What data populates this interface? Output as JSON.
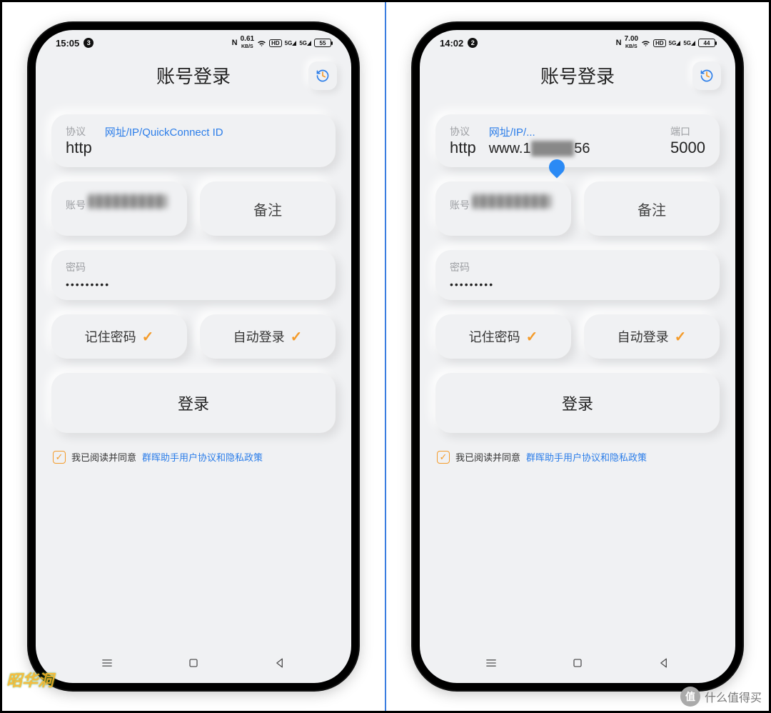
{
  "watermarks": {
    "left": "昭华洞",
    "right_char": "值",
    "right_text": "什么值得买"
  },
  "left": {
    "status": {
      "time": "15:05",
      "badge": "3",
      "kbs_n": "0.61",
      "kbs_u": "KB/S",
      "hd": "HD",
      "sig": "5G",
      "batt": "55"
    },
    "title": "账号登录",
    "addr": {
      "proto_label": "协议",
      "proto_value": "http",
      "main_label": "网址/IP/QuickConnect ID",
      "main_value": "",
      "port_label": "",
      "port_value": ""
    },
    "account_label": "账号",
    "note_label": "备注",
    "password_label": "密码",
    "password_mask": "•••••••••",
    "remember": "记住密码",
    "autologin": "自动登录",
    "login": "登录",
    "agree_text": "我已阅读并同意",
    "agree_link": "群晖助手用户协议和隐私政策"
  },
  "right": {
    "status": {
      "time": "14:02",
      "badge": "2",
      "kbs_n": "7.00",
      "kbs_u": "KB/S",
      "hd": "HD",
      "sig": "5G",
      "batt": "44"
    },
    "title": "账号登录",
    "addr": {
      "proto_label": "协议",
      "proto_value": "http",
      "main_label": "网址/IP/...",
      "main_value_pre": "www.1",
      "main_value_blur": "████",
      "main_value_post": "56",
      "port_label": "端口",
      "port_value": "5000"
    },
    "account_label": "账号",
    "note_label": "备注",
    "password_label": "密码",
    "password_mask": "•••••••••",
    "remember": "记住密码",
    "autologin": "自动登录",
    "login": "登录",
    "agree_text": "我已阅读并同意",
    "agree_link": "群晖助手用户协议和隐私政策"
  }
}
